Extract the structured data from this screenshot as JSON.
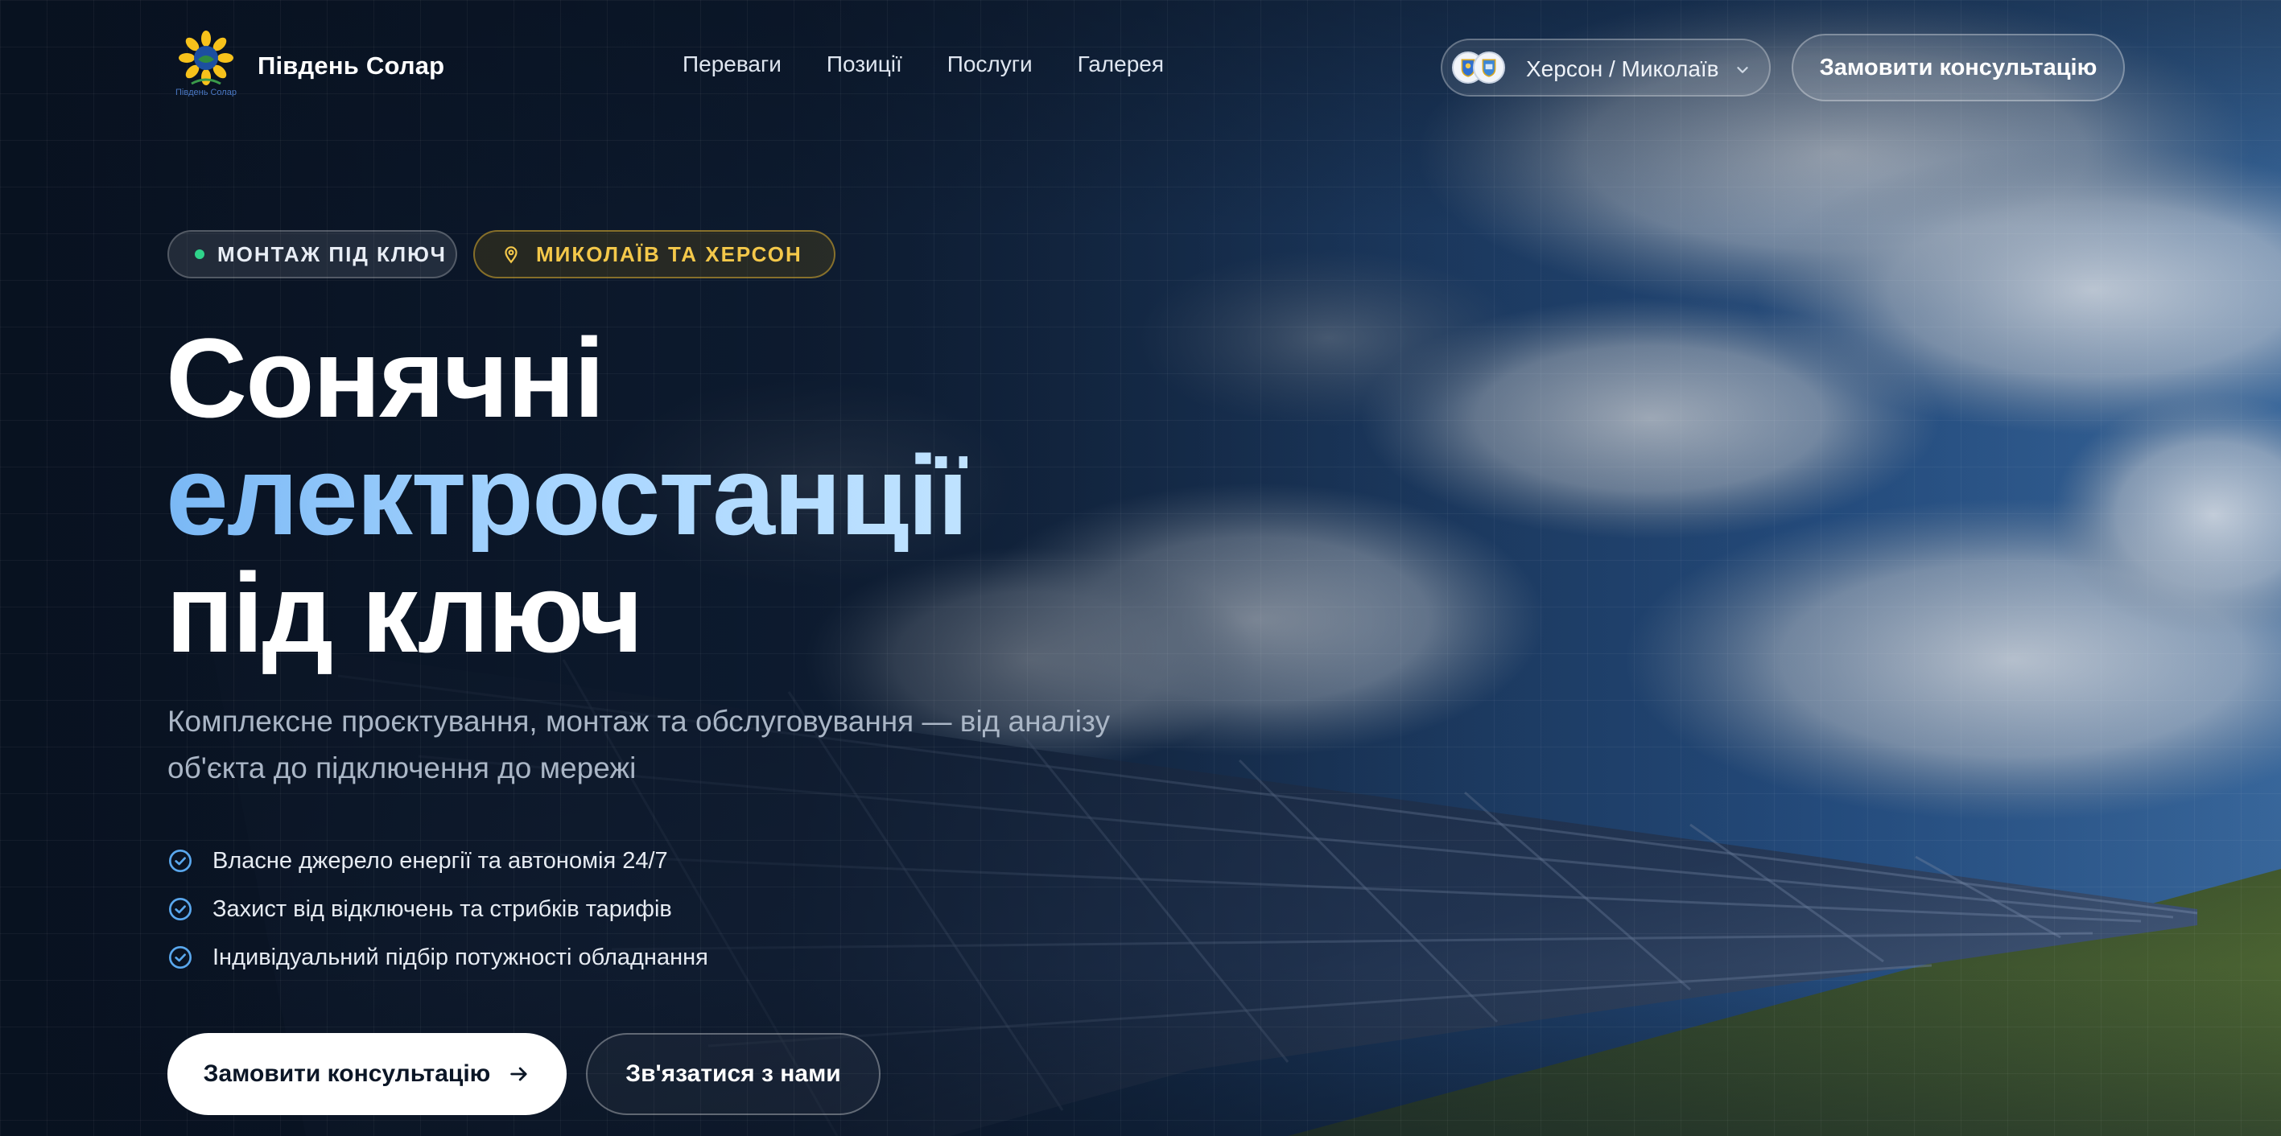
{
  "header": {
    "logo_text": "Південь Солар",
    "brand_name": "Південь Солар",
    "nav": [
      {
        "label": "Переваги"
      },
      {
        "label": "Позиції"
      },
      {
        "label": "Послуги"
      },
      {
        "label": "Галерея"
      }
    ],
    "region_selector": {
      "value": "Херсон / Миколаїв",
      "icon": "chevron-down-icon"
    },
    "cta_label": "Замовити консультацію"
  },
  "hero": {
    "badges": [
      {
        "label": "МОНТАЖ ПІД КЛЮЧ",
        "icon": "status-dot-icon",
        "color": "#2fd38a"
      },
      {
        "label": "МИКОЛАЇВ ТА ХЕРСОН",
        "icon": "location-pin-icon",
        "color": "#f4c84a"
      }
    ],
    "title_line1": "Сонячні",
    "title_line2": "електростанції",
    "title_line3": "під ключ",
    "subtitle": "Комплексне проєктування, монтаж та обслуговування — від аналізу об'єкта до підключення до мережі",
    "benefits": [
      "Власне джерело енергії та автономія 24/7",
      "Захист від відключень та стрибків тарифів",
      "Індивідуальний підбір потужності обладнання"
    ],
    "primary_button": "Замовити консультацію",
    "secondary_button": "Зв'язатися з нами"
  },
  "colors": {
    "accent_blue": "#7ab8f5",
    "accent_gold": "#f4c84a",
    "accent_green": "#2fd38a",
    "background": "#0b1626"
  }
}
